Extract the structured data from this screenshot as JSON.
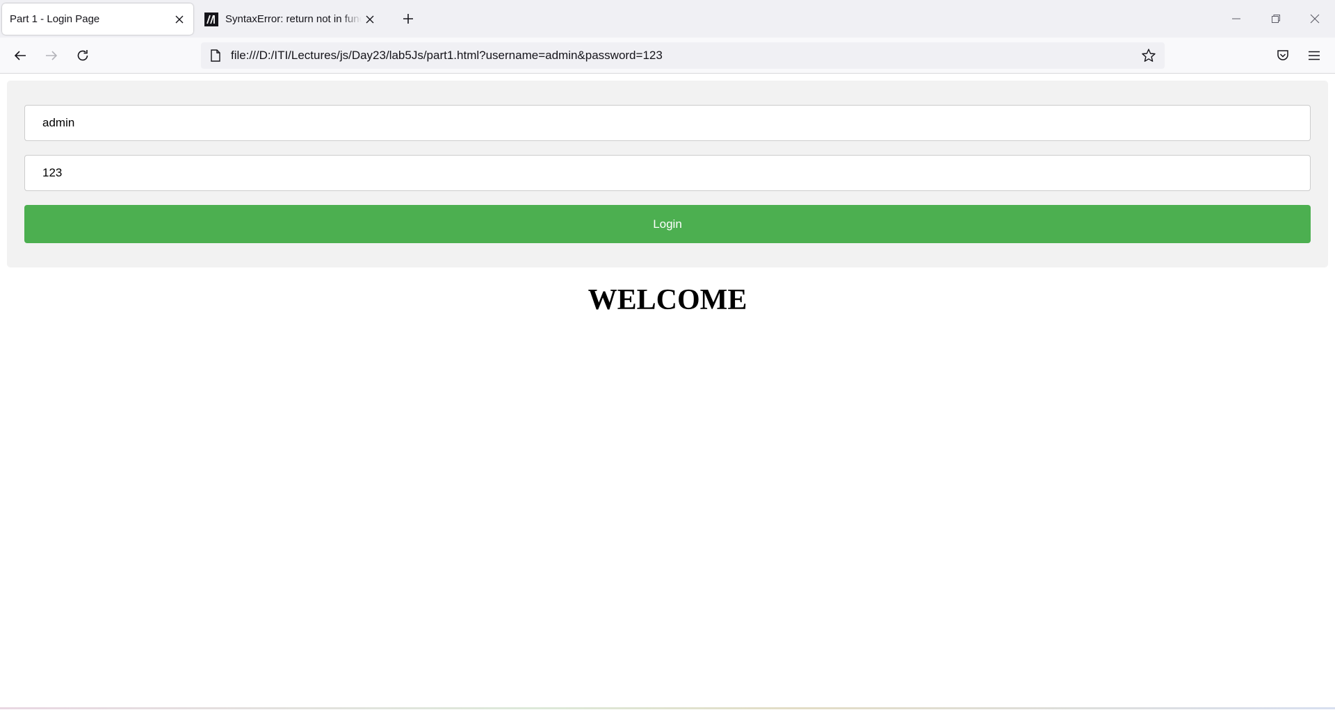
{
  "browser": {
    "tabs": [
      {
        "title": "Part 1 - Login Page",
        "active": true
      },
      {
        "title": "SyntaxError: return not in function",
        "active": false,
        "favicon": "mdn-icon"
      }
    ],
    "url": "file:///D:/ITI/Lectures/js/Day23/lab5Js/part1.html?username=admin&password=123",
    "icons": {
      "back": "back-arrow-icon",
      "forward": "forward-arrow-icon",
      "reload": "reload-icon",
      "page": "page-icon",
      "bookmark": "star-icon",
      "pocket": "pocket-icon",
      "menu": "hamburger-menu-icon",
      "minimize": "minimize-icon",
      "restore": "restore-icon",
      "close": "close-icon",
      "new_tab": "plus-icon"
    }
  },
  "form": {
    "username_value": "admin",
    "password_value": "123",
    "login_label": "Login"
  },
  "welcome_text": "WELCOME",
  "colors": {
    "login_button": "#4caf50",
    "panel_background": "#f2f2f2"
  }
}
